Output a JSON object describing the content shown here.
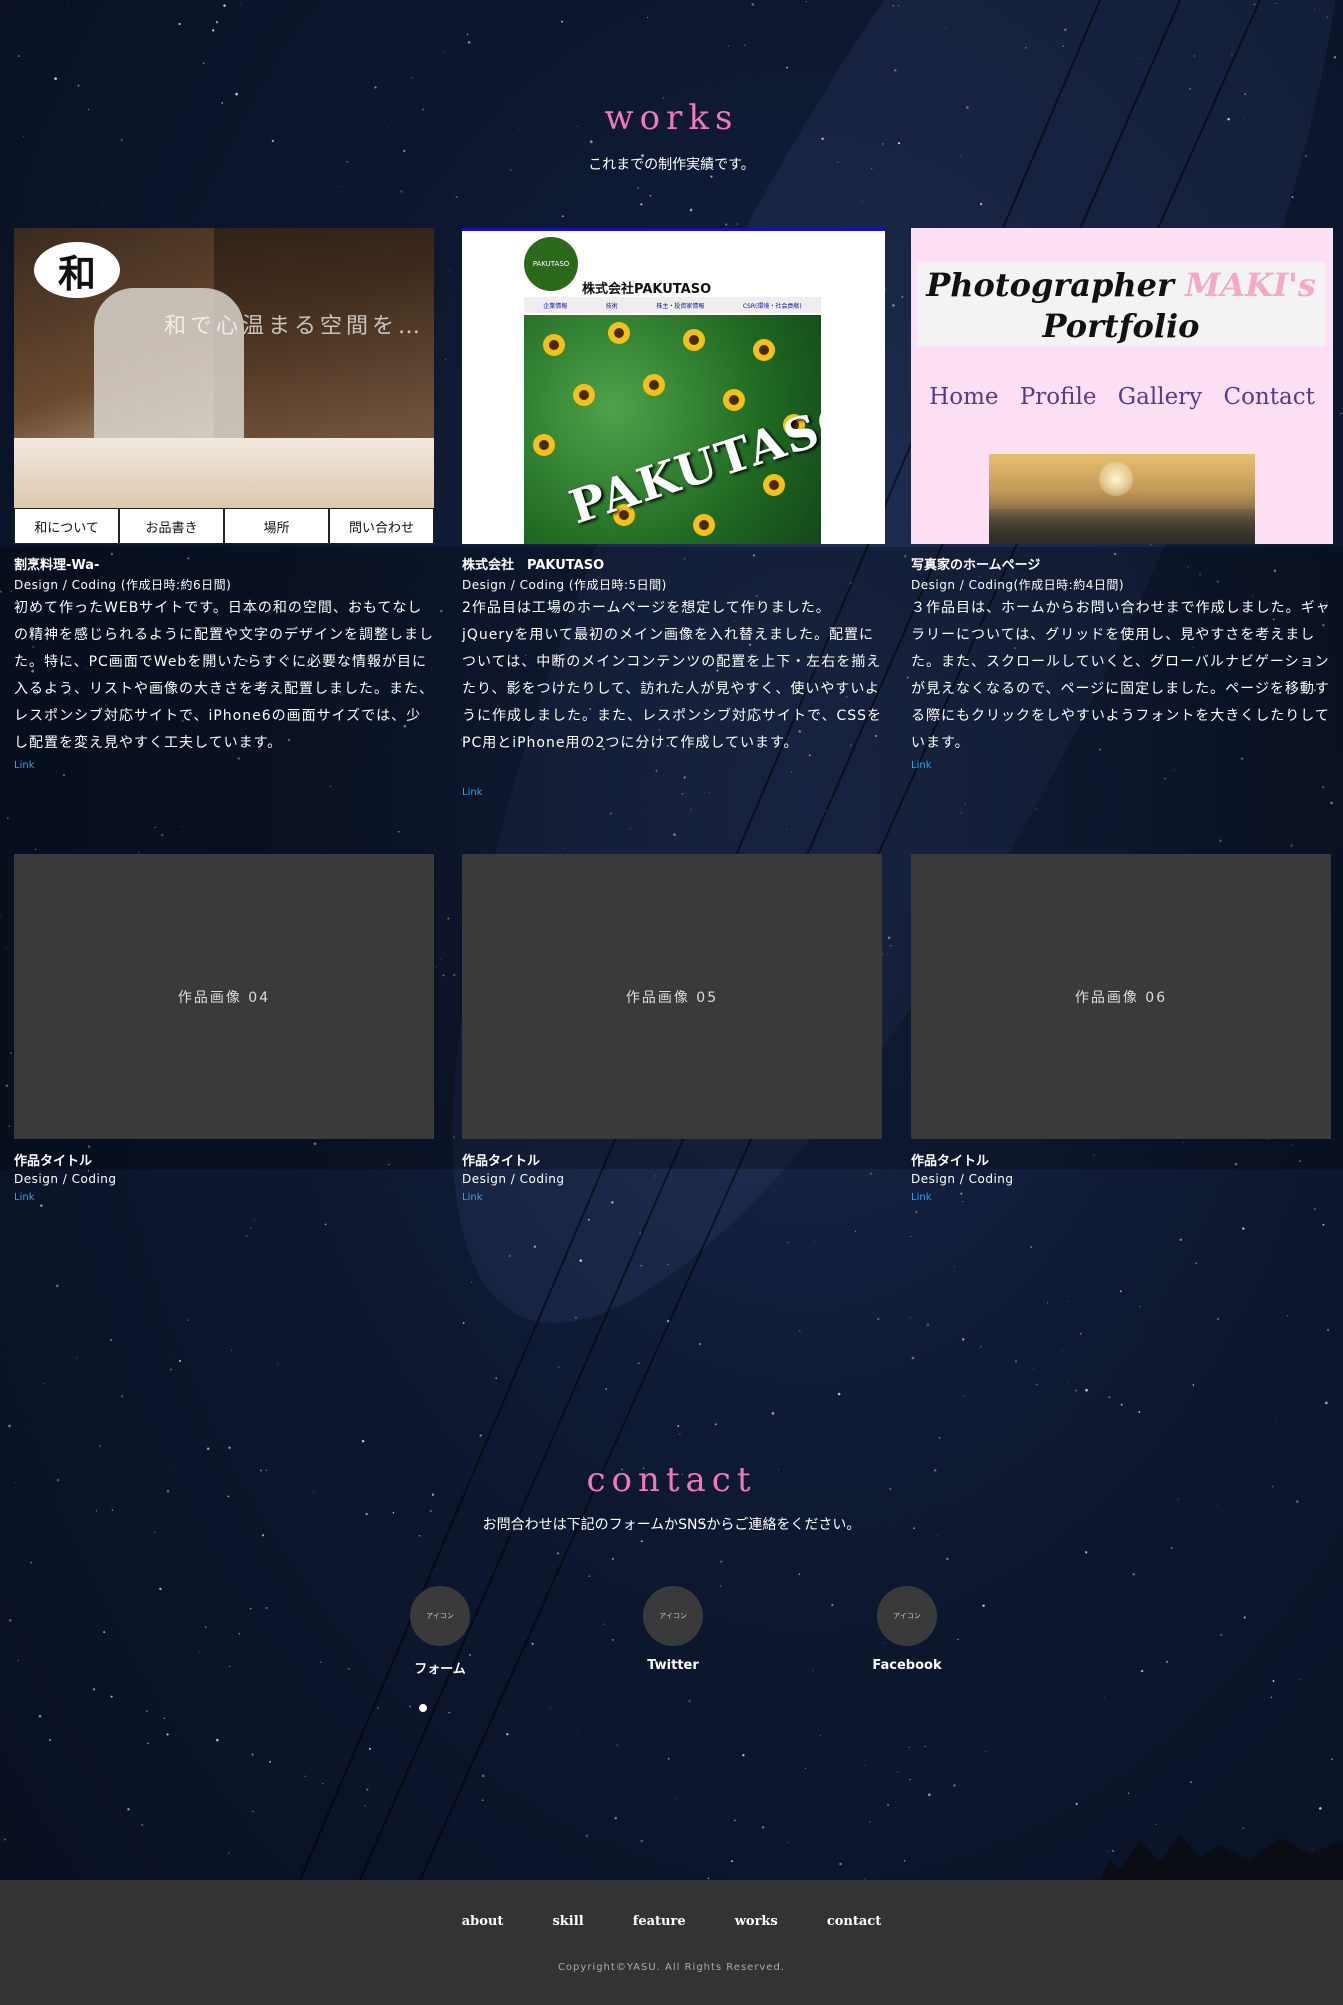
{
  "works": {
    "title": "works",
    "subtitle": "これまでの制作実績です。",
    "items": [
      {
        "title": "割烹料理-Wa-",
        "meta": "Design / Coding (作成日時:約6日間)",
        "description": "初めて作ったWEBサイトです。日本の和の空間、おもてなしの精神を感じられるように配置や文字のデザインを調整しました。特に、PC画面でWebを開いたらすぐに必要な情報が目に入るよう、リストや画像の大きさを考え配置しました。また、レスポンシブ対応サイトで、iPhone6の画面サイズでは、少し配置を変え見やすく工夫しています。",
        "link": "Link",
        "thumb": {
          "logo": "和",
          "catch": "和で心温まる空間を…",
          "nav": [
            "和について",
            "お品書き",
            "場所",
            "問い合わせ"
          ]
        }
      },
      {
        "title": "株式会社　PAKUTASO",
        "meta": "Design / Coding (作成日時:5日間)",
        "description": "2作品目は工場のホームページを想定して作りました。jQueryを用いて最初のメイン画像を入れ替えました。配置については、中断のメインコンテンツの配置を上下・左右を揃えたり、影をつけたりして、訪れた人が見やすく、使いやすいように作成しました。また、レスポンシブ対応サイトで、CSSをPC用とiPhone用の2つに分けて作成しています。",
        "link": "Link",
        "thumb": {
          "badge": "PAKUTASO",
          "company": "株式会社PAKUTASO",
          "nav": [
            "企業情報",
            "技術",
            "株主・投資家情報",
            "CSR(環境・社会貢献)"
          ],
          "hero": "PAKUTASO"
        }
      },
      {
        "title": "写真家のホームページ",
        "meta": "Design / Coding(作成日時:約4日間)",
        "description": "３作品目は、ホームからお問い合わせまで作成しました。ギャラリーについては、グリッドを使用し、見やすさを考えました。また、スクロールしていくと、グローバルナビゲーションが見えなくなるので、ページに固定しました。ページを移動する際にもクリックをしやすいようフォントを大きくしたりしています。",
        "link": "Link",
        "thumb": {
          "title_part1": "Photographer",
          "title_part2": "MAKI's",
          "title_line2": "Portfolio",
          "nav": [
            "Home",
            "Profile",
            "Gallery",
            "Contact"
          ]
        }
      },
      {
        "placeholder": "作品画像 04",
        "title": "作品タイトル",
        "meta": "Design / Coding",
        "link": "Link"
      },
      {
        "placeholder": "作品画像 05",
        "title": "作品タイトル",
        "meta": "Design / Coding",
        "link": "Link"
      },
      {
        "placeholder": "作品画像 06",
        "title": "作品タイトル",
        "meta": "Design / Coding",
        "link": "Link"
      }
    ]
  },
  "contact": {
    "title": "contact",
    "subtitle": "お問合わせは下記のフォームかSNSからご連絡をください。",
    "items": [
      {
        "icon_text": "アイコン",
        "label": "フォーム"
      },
      {
        "icon_text": "アイコン",
        "label": "Twitter"
      },
      {
        "icon_text": "アイコン",
        "label": "Facebook"
      }
    ]
  },
  "footer": {
    "nav": [
      "about",
      "skill",
      "feature",
      "works",
      "contact"
    ],
    "copyright": "Copyright©YASU. All Rights Reserved."
  },
  "colors": {
    "accent": "#f07ab8",
    "link": "#3a9ff0",
    "footer_bg": "#333333",
    "placeholder_bg": "#3a3a3a"
  }
}
